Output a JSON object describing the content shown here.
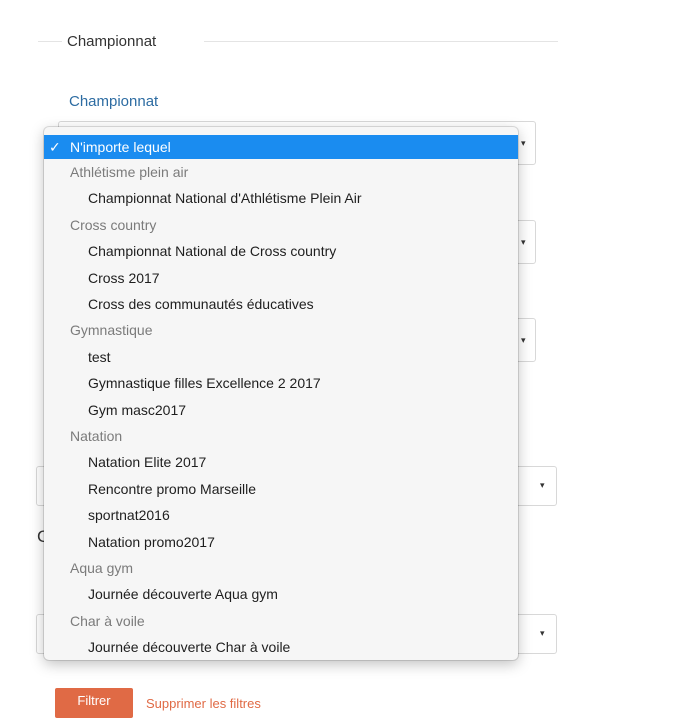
{
  "fieldset": {
    "legend": "Championnat",
    "label": "Championnat"
  },
  "dropdown": {
    "selected_label": "N'importe lequel",
    "check_mark": "✓",
    "rows": [
      {
        "kind": "group",
        "text": "Athlétisme plein air"
      },
      {
        "kind": "option",
        "text": "Championnat National d'Athlétisme Plein Air"
      },
      {
        "kind": "group",
        "text": "Cross country"
      },
      {
        "kind": "option",
        "text": "Championnat National de Cross country"
      },
      {
        "kind": "option",
        "text": "Cross 2017"
      },
      {
        "kind": "option",
        "text": "Cross des communautés éducatives"
      },
      {
        "kind": "group",
        "text": "Gymnastique"
      },
      {
        "kind": "option",
        "text": "test"
      },
      {
        "kind": "option",
        "text": "Gymnastique filles Excellence 2 2017"
      },
      {
        "kind": "option",
        "text": "Gym masc2017"
      },
      {
        "kind": "group",
        "text": "Natation"
      },
      {
        "kind": "option",
        "text": "Natation Elite 2017"
      },
      {
        "kind": "option",
        "text": "Rencontre promo Marseille"
      },
      {
        "kind": "option",
        "text": "sportnat2016"
      },
      {
        "kind": "option",
        "text": "Natation promo2017"
      },
      {
        "kind": "group",
        "text": "Aqua gym"
      },
      {
        "kind": "option",
        "text": "Journée découverte Aqua gym"
      },
      {
        "kind": "group",
        "text": "Char à voile"
      },
      {
        "kind": "option",
        "text": "Journée découverte Char à voile"
      }
    ]
  },
  "form": {
    "caret_glyph": "▾",
    "partial_label_letter": "C",
    "filter_button": "Filtrer",
    "clear_link": "Supprimer les filtres"
  },
  "colors": {
    "accent_link": "#2d6ca2",
    "selection_blue": "#1a8cf0",
    "button_orange": "#e06a45"
  }
}
